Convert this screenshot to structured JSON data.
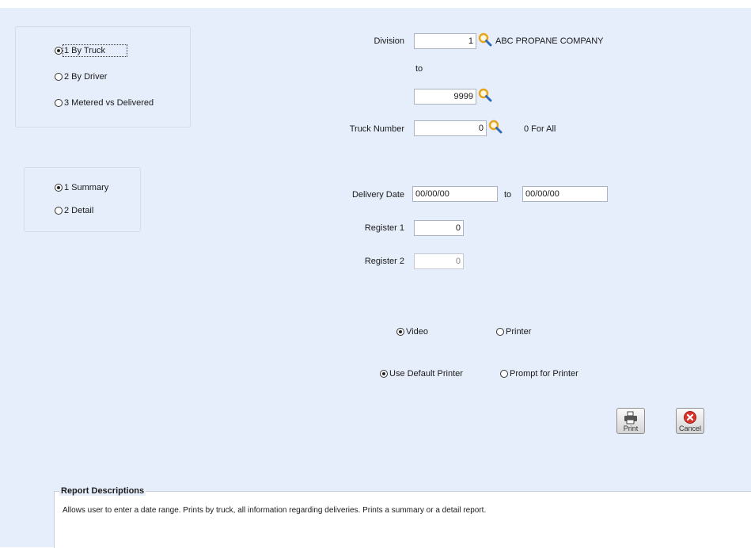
{
  "report_type": {
    "options": [
      "1 By Truck",
      "2 By Driver",
      "3 Metered vs Delivered"
    ],
    "selected": 0
  },
  "report_detail": {
    "options": [
      "1 Summary",
      "2 Detail"
    ],
    "selected": 0
  },
  "division": {
    "label": "Division",
    "from_value": "1",
    "company_name": "ABC PROPANE COMPANY",
    "to_label": "to",
    "to_value": "9999"
  },
  "truck": {
    "label": "Truck Number",
    "value": "0",
    "hint": "0 For All"
  },
  "delivery_date": {
    "label": "Delivery Date",
    "from": "00/00/00",
    "to_label": "to",
    "to": "00/00/00"
  },
  "register1": {
    "label": "Register 1",
    "value": "0"
  },
  "register2": {
    "label": "Register 2",
    "value": "0"
  },
  "output": {
    "video_label": "Video",
    "printer_label": "Printer",
    "selected": "video"
  },
  "printer_choice": {
    "default_label": "Use Default Printer",
    "prompt_label": "Prompt for Printer",
    "selected": "default"
  },
  "buttons": {
    "print_label": "Print",
    "cancel_label": "Cancel"
  },
  "report_descriptions": {
    "title": "Report Descriptions",
    "text": "Allows user to enter a date range. Prints by truck, all information regarding deliveries. Prints a summary or a detail report."
  },
  "icons": {
    "search": "magnifier-icon",
    "print": "printer-icon",
    "cancel": "cancel-x-icon"
  },
  "colors": {
    "panel_bg": "#e6eefc",
    "magnifier": "#e8a317",
    "cancel_red": "#d9342b"
  }
}
